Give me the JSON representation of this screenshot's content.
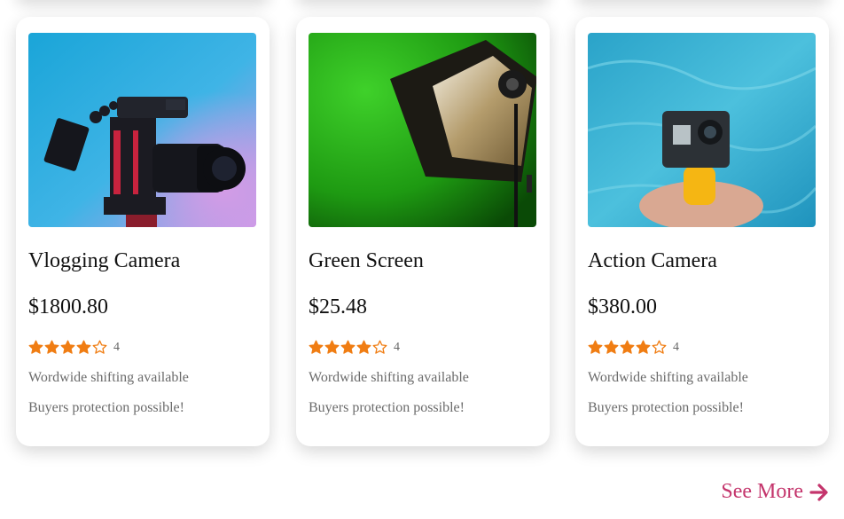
{
  "products": [
    {
      "title": "Vlogging Camera",
      "price": "$1800.80",
      "rating_stars": 4,
      "rating_count": "4",
      "line1": "Wordwide shifting available",
      "line2": "Buyers protection possible!",
      "image": "vlogging-camera-photo"
    },
    {
      "title": "Green Screen",
      "price": "$25.48",
      "rating_stars": 4,
      "rating_count": "4",
      "line1": "Wordwide shifting available",
      "line2": "Buyers protection possible!",
      "image": "green-screen-photo"
    },
    {
      "title": "Action Camera",
      "price": "$380.00",
      "rating_stars": 4,
      "rating_count": "4",
      "line1": "Wordwide shifting available",
      "line2": "Buyers protection possible!",
      "image": "action-camera-photo"
    }
  ],
  "see_more": {
    "label": "See More",
    "icon": "arrow-right-icon"
  },
  "colors": {
    "star": "#f07d13",
    "accent": "#c4356c",
    "muted_text": "#6b6b6b"
  }
}
